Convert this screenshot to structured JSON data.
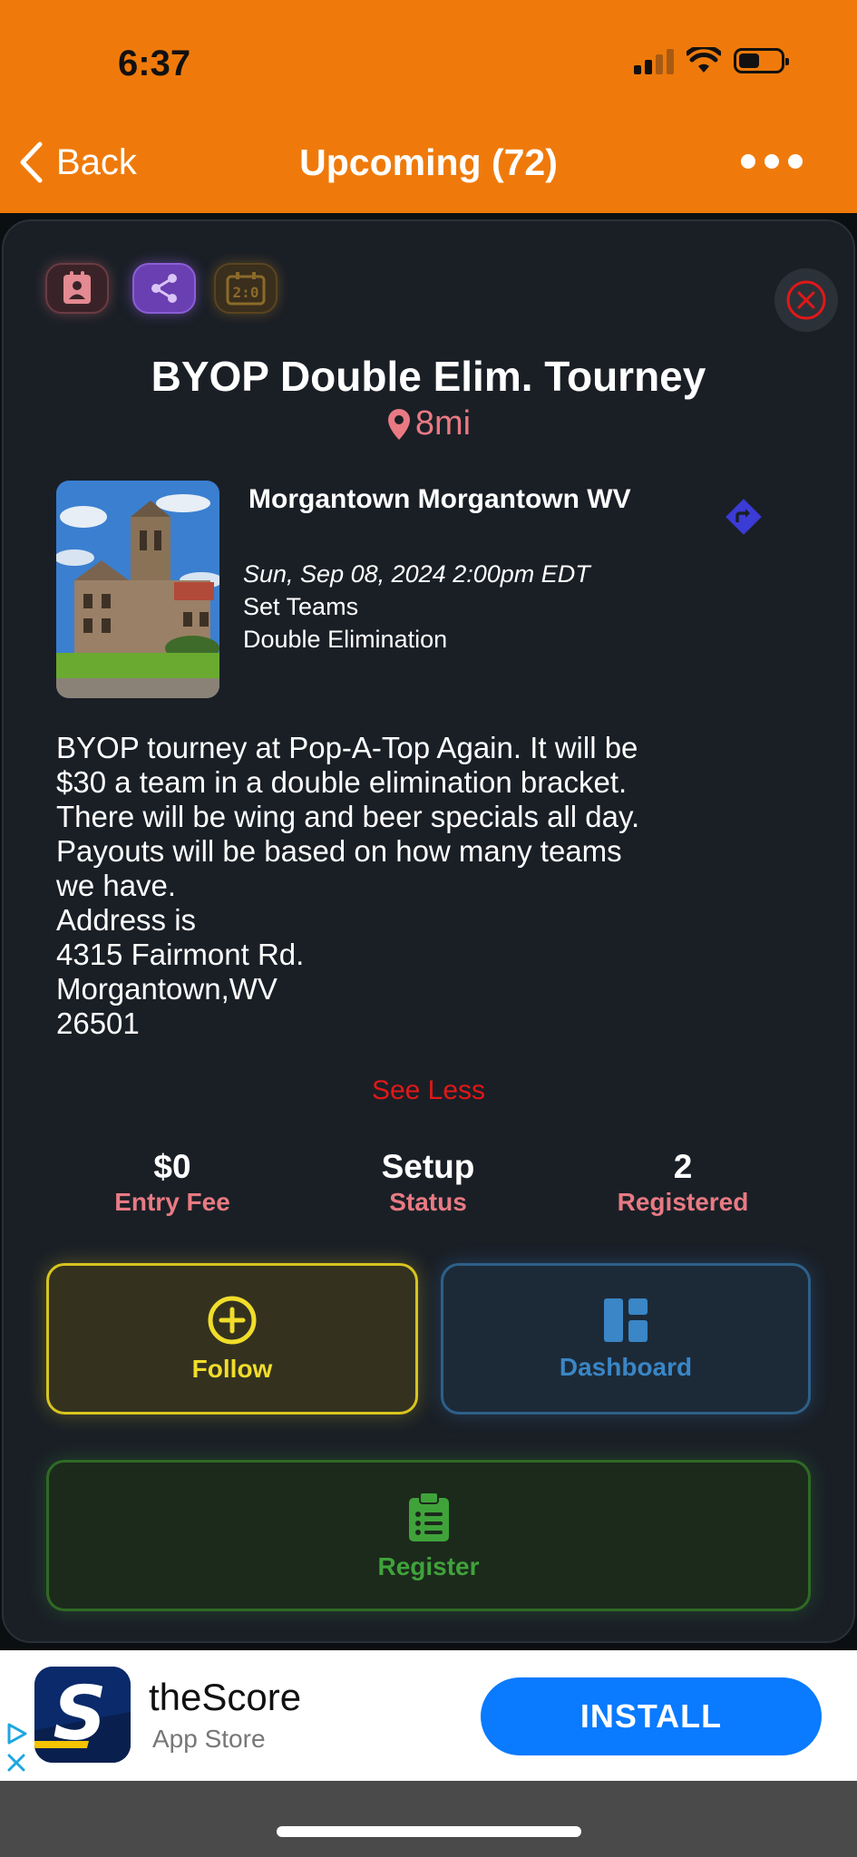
{
  "status_bar": {
    "time": "6:37"
  },
  "nav": {
    "back_label": "Back",
    "title": "Upcoming (72)"
  },
  "event": {
    "title": "BYOP Double Elim. Tourney",
    "distance": "8mi",
    "venue": "Morgantown Morgantown WV",
    "date": "Sun, Sep 08, 2024 2:00pm EDT",
    "format_line1": "Set Teams",
    "format_line2": "Double Elimination",
    "description_lines": [
      "BYOP tourney at Pop-A-Top Again. It will be",
      "$30 a team in a double elimination bracket.",
      "There will be wing and beer specials all day.",
      "Payouts will be based on how many teams",
      "we have.",
      "Address is",
      "4315 Fairmont Rd.",
      "Morgantown,WV",
      "26501"
    ],
    "see_less": "See Less"
  },
  "stats": {
    "entry_fee": {
      "value": "$0",
      "label": "Entry Fee"
    },
    "status": {
      "value": "Setup",
      "label": "Status"
    },
    "registered": {
      "value": "2",
      "label": "Registered"
    }
  },
  "actions": {
    "follow": "Follow",
    "dashboard": "Dashboard",
    "register": "Register"
  },
  "ad": {
    "app_name": "theScore",
    "store": "App Store",
    "install": "INSTALL"
  },
  "icons": [
    "contact-card-icon",
    "share-icon",
    "scoreboard-icon",
    "close-icon",
    "location-pin-icon",
    "directions-icon",
    "plus-circle-icon",
    "dashboard-icon",
    "clipboard-icon"
  ],
  "colors": {
    "header": "#EF7A0B",
    "card": "#1A1F26",
    "accent_pink": "#E97A83",
    "see_less": "#E01818",
    "follow": "#F1DD2A",
    "dashboard": "#3A86C6",
    "register": "#3FA33A",
    "install": "#0A7AFF"
  }
}
